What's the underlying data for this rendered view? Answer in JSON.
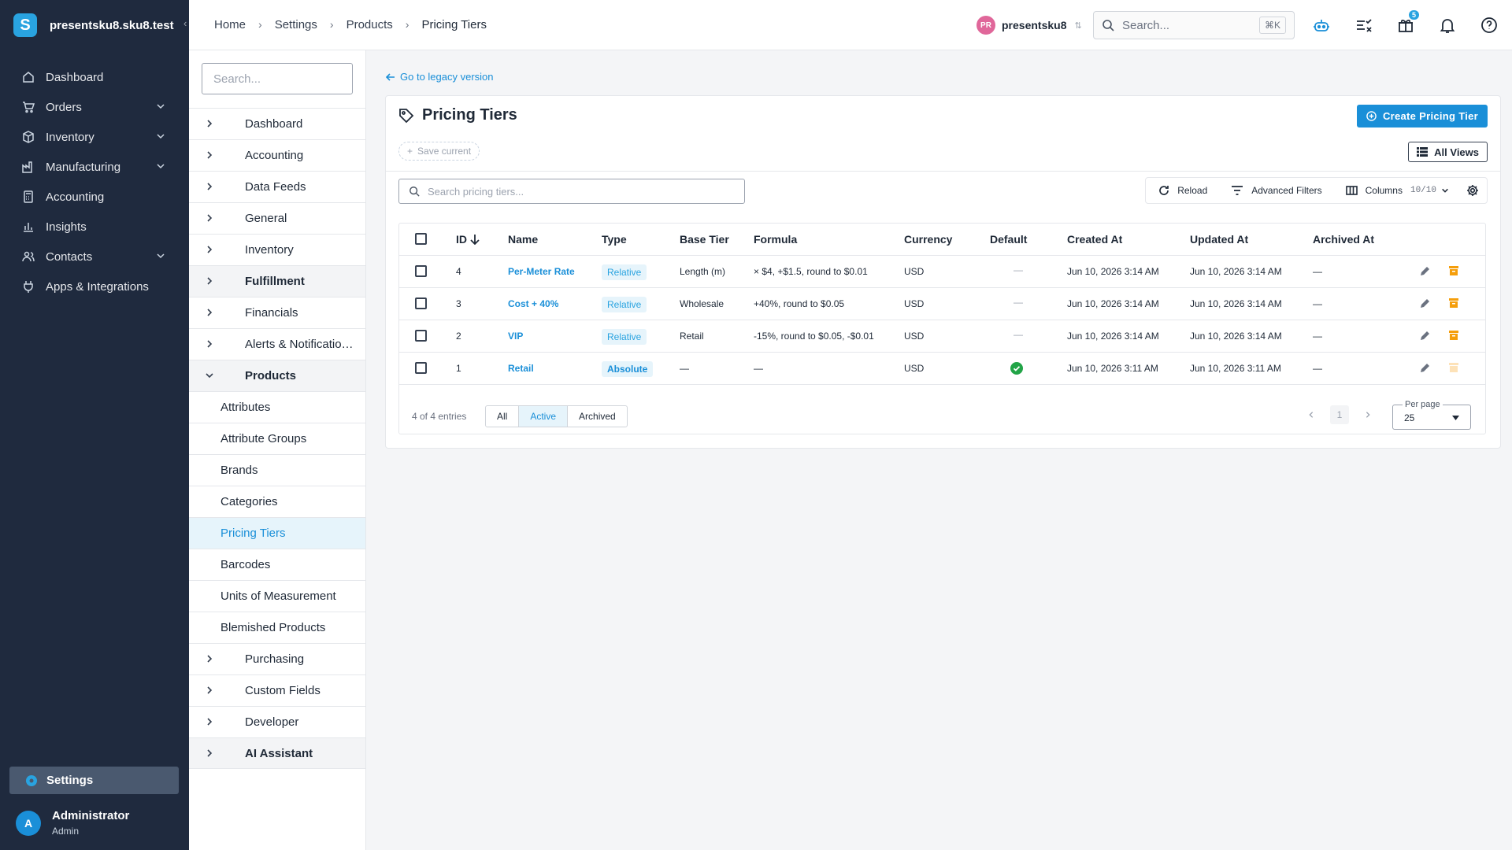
{
  "app": {
    "name": "presentsku8.sku8.test",
    "logo_letter": "S"
  },
  "sidebar": {
    "items": [
      {
        "label": "Dashboard",
        "icon": "home-icon",
        "expandable": false
      },
      {
        "label": "Orders",
        "icon": "cart-icon",
        "expandable": true
      },
      {
        "label": "Inventory",
        "icon": "box-icon",
        "expandable": true
      },
      {
        "label": "Manufacturing",
        "icon": "factory-icon",
        "expandable": true
      },
      {
        "label": "Accounting",
        "icon": "calculator-icon",
        "expandable": false
      },
      {
        "label": "Insights",
        "icon": "chart-icon",
        "expandable": false
      },
      {
        "label": "Contacts",
        "icon": "contacts-icon",
        "expandable": true
      },
      {
        "label": "Apps & Integrations",
        "icon": "plug-icon",
        "expandable": false
      }
    ],
    "settings_label": "Settings",
    "user": {
      "initial": "A",
      "name": "Administrator",
      "role": "Admin"
    }
  },
  "topbar": {
    "breadcrumbs": [
      "Home",
      "Settings",
      "Products",
      "Pricing Tiers"
    ],
    "account": {
      "initials": "PR",
      "name": "presentsku8"
    },
    "search": {
      "placeholder": "Search...",
      "shortcut": "⌘K"
    },
    "gift_badge": "5"
  },
  "subnav": {
    "search_placeholder": "Search...",
    "sections": [
      {
        "label": "Dashboard"
      },
      {
        "label": "Accounting"
      },
      {
        "label": "Data Feeds"
      },
      {
        "label": "General"
      },
      {
        "label": "Inventory"
      },
      {
        "label": "Fulfillment"
      },
      {
        "label": "Financials"
      },
      {
        "label": "Alerts & Notificatio…"
      },
      {
        "label": "Products"
      },
      {
        "label": "Purchasing"
      },
      {
        "label": "Custom Fields"
      },
      {
        "label": "Developer"
      },
      {
        "label": "AI Assistant"
      }
    ],
    "products_children": [
      "Attributes",
      "Attribute Groups",
      "Brands",
      "Categories",
      "Pricing Tiers",
      "Barcodes",
      "Units of Measurement",
      "Blemished Products"
    ]
  },
  "main": {
    "legacy_link": "Go to legacy version",
    "title": "Pricing Tiers",
    "create_button": "Create Pricing Tier",
    "save_current": "Save current",
    "all_views": "All Views",
    "table_search_placeholder": "Search pricing tiers...",
    "tools": {
      "reload": "Reload",
      "filters": "Advanced Filters",
      "columns": "Columns",
      "columns_count": "10/10"
    },
    "columns": [
      "ID",
      "Name",
      "Type",
      "Base Tier",
      "Formula",
      "Currency",
      "Default",
      "Created At",
      "Updated At",
      "Archived At"
    ],
    "rows": [
      {
        "id": "4",
        "name": "Per-Meter Rate",
        "type": "Relative",
        "base_tier": "Length (m)",
        "formula": "× $4, +$1.5, round to $0.01",
        "currency": "USD",
        "default": "—",
        "created": "Jun 10, 2026 3:14 AM",
        "updated": "Jun 10, 2026 3:14 AM",
        "archived": "—"
      },
      {
        "id": "3",
        "name": "Cost + 40%",
        "type": "Relative",
        "base_tier": "Wholesale",
        "formula": "+40%, round to $0.05",
        "currency": "USD",
        "default": "—",
        "created": "Jun 10, 2026 3:14 AM",
        "updated": "Jun 10, 2026 3:14 AM",
        "archived": "—"
      },
      {
        "id": "2",
        "name": "VIP",
        "type": "Relative",
        "base_tier": "Retail",
        "formula": "-15%, round to $0.05, -$0.01",
        "currency": "USD",
        "default": "—",
        "created": "Jun 10, 2026 3:14 AM",
        "updated": "Jun 10, 2026 3:14 AM",
        "archived": "—"
      },
      {
        "id": "1",
        "name": "Retail",
        "type": "Absolute",
        "base_tier": "—",
        "formula": "—",
        "currency": "USD",
        "default": "check",
        "created": "Jun 10, 2026 3:11 AM",
        "updated": "Jun 10, 2026 3:11 AM",
        "archived": "—"
      }
    ],
    "footer": {
      "entries": "4 of 4 entries",
      "filters": [
        "All",
        "Active",
        "Archived"
      ],
      "active_filter": "Active",
      "page": "1",
      "per_page_label": "Per page",
      "per_page": "25"
    }
  },
  "colors": {
    "sidebar_bg": "#1f2a3e",
    "accent": "#1a8fd8",
    "archive_orange": "#f59e0b",
    "success_green": "#22a447"
  }
}
